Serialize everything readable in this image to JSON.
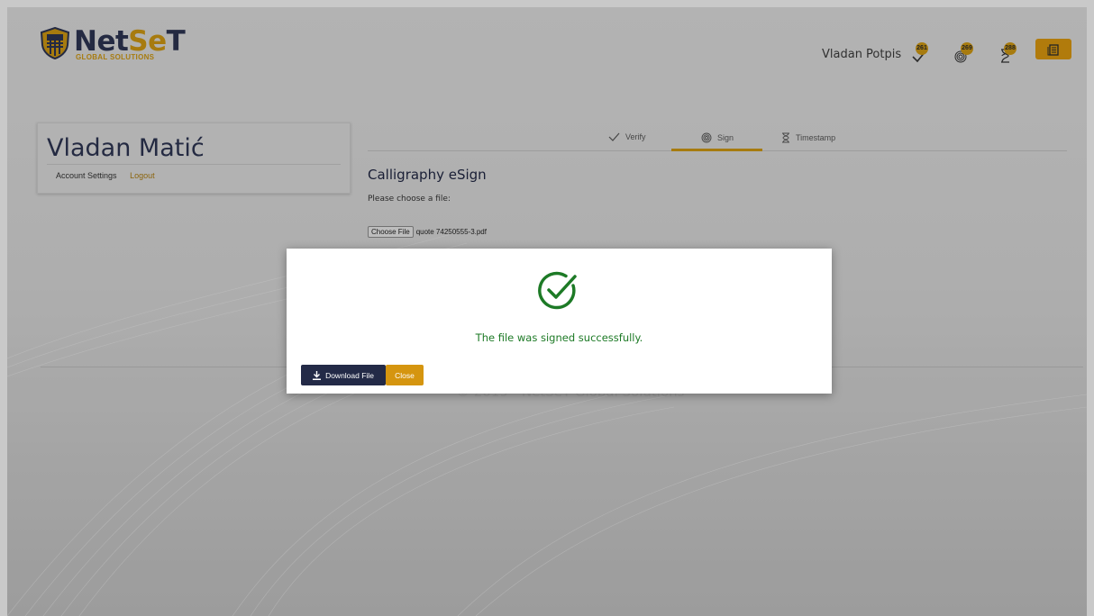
{
  "brand": {
    "name_part1": "Net",
    "name_part2": "Se",
    "name_part3": "T",
    "subtitle": "GLOBAL SOLUTIONS"
  },
  "header": {
    "user_name": "Vladan Potpis",
    "counters": [
      {
        "icon": "check-icon",
        "count": "261"
      },
      {
        "icon": "fingerprint-icon",
        "count": "269"
      },
      {
        "icon": "hourglass-icon",
        "count": "288"
      }
    ],
    "menu_icon": "document-list-icon"
  },
  "profile": {
    "name": "Vladan Matić",
    "account_settings": "Account Settings",
    "logout": "Logout"
  },
  "tabs": [
    {
      "label": "Verify",
      "icon": "check-icon",
      "active": false
    },
    {
      "label": "Sign",
      "icon": "fingerprint-icon",
      "active": true
    },
    {
      "label": "Timestamp",
      "icon": "hourglass-icon",
      "active": false
    }
  ],
  "main": {
    "title": "Calligraphy eSign",
    "prompt": "Please choose a file:",
    "file_button": "Choose File",
    "file_name": "quote 74250555-3.pdf"
  },
  "footer": {
    "copyright": "© 2019 - NetSeT Global Solutions"
  },
  "modal": {
    "icon": "success-check-circle-icon",
    "message": "The file was signed successfully.",
    "download_label": "Download File",
    "close_label": "Close"
  },
  "colors": {
    "brand_navy": "#2c3350",
    "brand_gold": "#c99513",
    "success_green": "#1d7a26",
    "download_button": "#232a47",
    "close_button": "#d5950f"
  }
}
